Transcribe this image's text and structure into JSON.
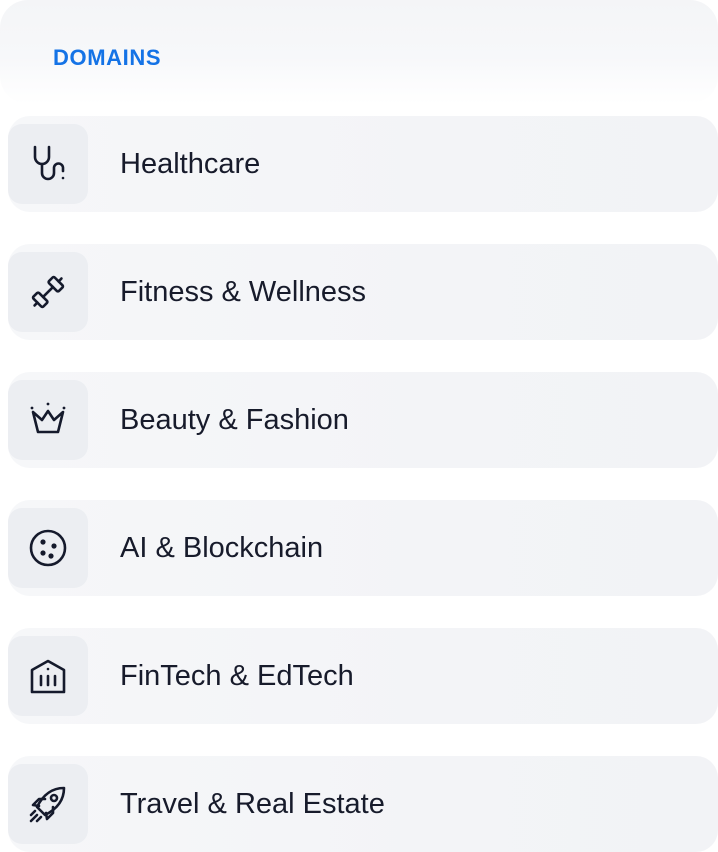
{
  "header": {
    "title": "DOMAINS"
  },
  "colors": {
    "accent": "#1473e6",
    "text": "#171b2b",
    "icon": "#151a2c"
  },
  "domains": [
    {
      "label": "Healthcare",
      "icon": "stethoscope-icon"
    },
    {
      "label": "Fitness & Wellness",
      "icon": "dumbbell-icon"
    },
    {
      "label": "Beauty & Fashion",
      "icon": "crown-icon"
    },
    {
      "label": "AI & Blockchain",
      "icon": "circle-dots-icon"
    },
    {
      "label": "FinTech & EdTech",
      "icon": "bank-icon"
    },
    {
      "label": "Travel & Real Estate",
      "icon": "rocket-icon"
    }
  ]
}
